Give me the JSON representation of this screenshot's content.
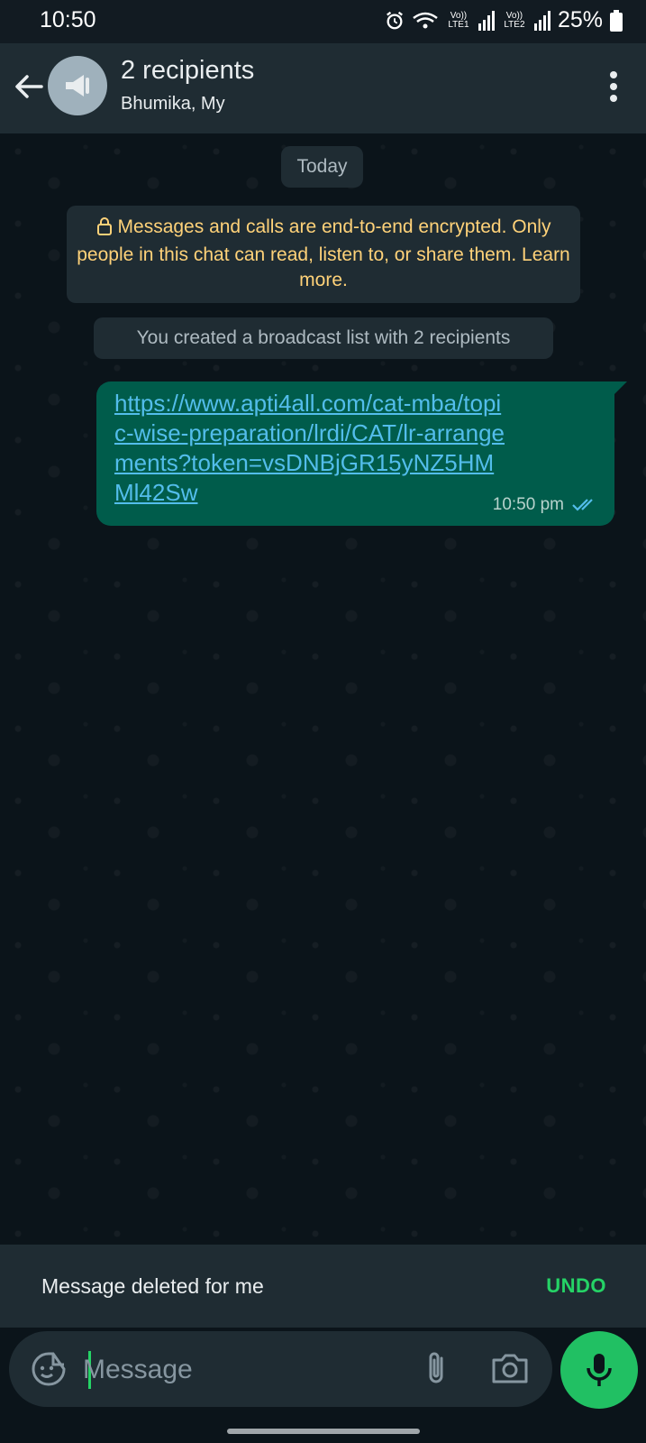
{
  "status_bar": {
    "time": "10:50",
    "sim1_label": "Vo)) LTE1",
    "sim2_label": "Vo)) LTE2",
    "battery": "25%"
  },
  "header": {
    "title": "2 recipients",
    "subtitle": "Bhumika, My"
  },
  "chat": {
    "date_chip": "Today",
    "encryption_notice": "Messages and calls are end-to-end encrypted. Only people in this chat can read, listen to, or share them. Learn more.",
    "system_message": "You created a broadcast list with 2 recipients",
    "messages": [
      {
        "text": "https://www.apti4all.com/cat-mba/topic-wise-preparation/lrdi/CAT/lr-arrangements?token=vsDNBjGR15yNZ5HMMl42Sw",
        "time": "10:50 pm",
        "status": "read"
      }
    ]
  },
  "snackbar": {
    "text": "Message deleted for me",
    "action": "UNDO"
  },
  "composer": {
    "placeholder": "Message"
  },
  "colors": {
    "accent": "#25d366",
    "bubble_out": "#005c4b",
    "link": "#53bdeb",
    "notice": "#ffd279"
  },
  "icons": [
    "back-arrow-icon",
    "broadcast-icon",
    "more-vert-icon",
    "lock-icon",
    "double-check-icon",
    "sticker-icon",
    "attach-icon",
    "camera-icon",
    "mic-icon"
  ]
}
